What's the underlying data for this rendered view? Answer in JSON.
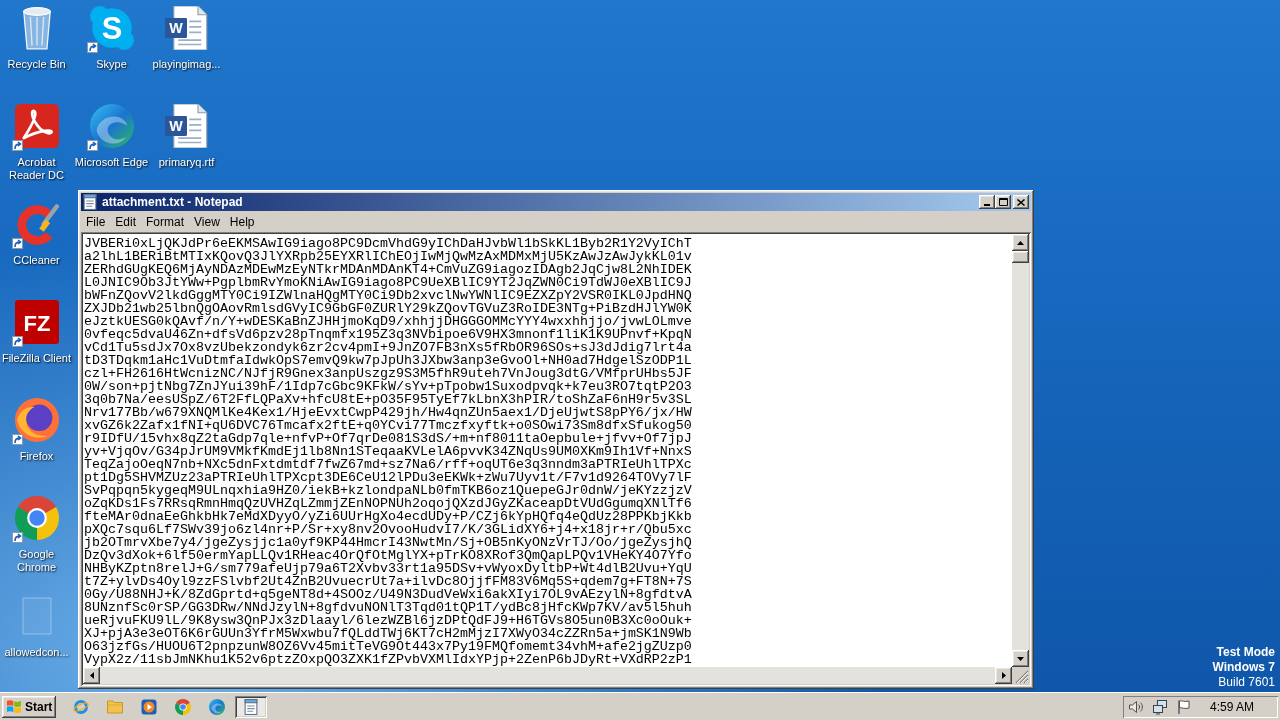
{
  "desktop": {
    "columns": [
      {
        "icons": [
          {
            "label": "Recycle Bin",
            "kind": "recycle-bin",
            "shortcut": false
          },
          {
            "label": "Acrobat Reader DC",
            "kind": "acrobat",
            "shortcut": true
          },
          {
            "label": "CCleaner",
            "kind": "ccleaner",
            "shortcut": true
          },
          {
            "label": "FileZilla Client",
            "kind": "filezilla",
            "glyph": "FZ",
            "shortcut": true
          },
          {
            "label": "Firefox",
            "kind": "firefox",
            "shortcut": true
          },
          {
            "label": "Google Chrome",
            "kind": "chrome",
            "shortcut": true
          },
          {
            "label": "allowedcon...",
            "kind": "blank",
            "shortcut": false
          }
        ]
      },
      {
        "icons": [
          {
            "label": "Skype",
            "kind": "skype",
            "glyph": "S",
            "shortcut": true
          },
          {
            "label": "Microsoft Edge",
            "kind": "edge",
            "shortcut": true
          }
        ]
      },
      {
        "icons": [
          {
            "label": "playingimag...",
            "kind": "word",
            "glyph": "W",
            "shortcut": false
          },
          {
            "label": "primaryq.rtf",
            "kind": "word",
            "glyph": "W",
            "shortcut": false
          }
        ]
      }
    ]
  },
  "notepad": {
    "title": "attachment.txt - Notepad",
    "menu": [
      "File",
      "Edit",
      "Format",
      "View",
      "Help"
    ],
    "lines": [
      "JVBERi0xLjQKJdPr6eEKMSAwIG9iago8PC9DcmVhdG9yIChDaHJvbWl1bSkKL1Byb2R1Y2VyIChT",
      "a2lhL1BERiBtMTIxKQovQ3JlYXRpb25EYXRlIChEOjIwMjQwMzAxMDMxMjU5KzAwJzAwJykKL01v",
      "ZERhdGUgKEQ6MjAyNDAzMDEwMzEyNTkrMDAnMDAnKT4+CmVuZG9iagozIDAgb2JqCjw8L2NhIDEK",
      "L0JNIC9Ob3JtYWw+PgplbmRvYmoKNiAwIG9iago8PC9UeXBlIC9YT2JqZWN0Ci9TdWJ0eXBlIC9J",
      "bWFnZQovV2lkdGggMTY0Ci9IZWlnaHQgMTY0Ci9Db2xvclNwYWNlIC9EZXZpY2VSR0IKL0JpdHNQ",
      "ZXJDb21wb25lbnQgOAovRmlsdGVyIC9GbGF0ZURlY29kZQovTGVuZ3RoIDE3NTg+PiBzdHJlYW0K",
      "eJztkUESG0kQAvf/n/Y+wDESKaBnZJHHjmoKqD9/xhhjjDHGGGOMMcYYY4wxxhhjjo/jvwLOLmve",
      "0vfeqc5dvaU46Zn+dfsVd6pzv28pTnqmfx195Z3q3NVbipoe6V9HX3mnonf1liK1K9UPnvf+KpqN",
      "vCd1Tu5sdJx7Ox8vzUbekzondyk6zr2cv4pmI+9JnZO7FB3nXs5fRbOR96SOs+sJ3dJdig7lrt4a",
      "tD3TDqkm1aHc1VuDtmfaIdwkOpS7emvQ9kw7pJpUh3JXbw3anp3eGvoOl+NH0ad7HdgelSzODP1L",
      "czl+FH2616HtWcnizNC/NJfjR9Gnex3anpUszgz9S3M5fhR9uteh7VnJoug3dtG/VMfprUHbs5JF",
      "0W/son+pjtNbg7ZnJYui39hF/1Idp7cGbc9KFkW/sYv+pTpobw1Suxodpvqk+k7eu3RO7tqtP2O3",
      "3q0b7Na/eesUSpZ/6T2FfLQPaXv+hfcU8tE+pO35F95TyEf7kLbnX3hPIR/toShZaF6nH9r5v3SL",
      "Nrv177Bb/w679XNQMlKe4Kex1/HjeEvxtCwpP429jh/Hw4qnZUn5aex1/DjeUjwtS8pPY6/jx/HW",
      "xvGZ6k2Zafx1fNI+qU6DVC76Tmcafx2ftE+q0YCvi77Tmczfxyftk+o0SOwi73Sm8dfxSfukog50",
      "r9IDfU/15vhx8qZ2taGdp7qle+nfvP+Of7qrDe081S3dS/+m+nf8011taOepbule+jfvv+Of7jpJ",
      "yv+VjqOv/G34pJrUM9VMkfKmdEj1lb8Nn1STeqaaKVLelA6pvvK34ZNqUs9UM0XKm9Ih1Vf+NnxS",
      "TeqZajoOeqN7nb+NXc5dnFxtdmtdf7fwZ67md+sz7Na6/rff+oqUT6e3q3nndm3aPTRIeUhlTPXc",
      "pt1Dg5SHVMZUz23aPTRIeUhlTPXcpt3DE6CeU12lPDu3eEKWk+zWu7Uyv1t/F7v1d9264TOVy7lF",
      "SvPqpqn5kygeqM9ULnqxhia9HZ0/iekB+kzlondpaNLb0fmTKB6oz1QuepeGJr0dnW/jeKYzzjzV",
      "oZqKDs1Fs7RRsqRmnHmqQzUVHZqLZmmjZEnNOPNUh2oqojQXzdJGyZKaceapDtVUdGgumqXNlTf6",
      "fteMAr0dnaEeGhkbHk7eMdXDyyO/yZi6UUrHgXo4ecdUDy+P/CZj6kYpHQfq4eQdUz28PPKbjKkb",
      "pXQc7squ6Lf7SWv39jo6zl4nr+P/Sr+xy8nv2OvooHudvI7/K/3GLidXY6+j4+x18jr+r/Qbu5xc",
      "jb2OTmrvXbe7y4/jgeZysjjc1a0yf9KP44HmcrI43NwtMn/Sj+OB5nKyONzVrTJ/Oo/jgeZysjhQ",
      "DzQv3dXok+6lf50ermYapLLQv1RHeac4OrQfOtMglYX+pTrKO8XRof3QmQapLPQv1VHeKY4O7Yfo",
      "NHByKZptn8relJ+G/sm779afeUjp79a6T2Xvbv33rt1a95DSv+vWyoxDyltbP+Wt4dlB2Uvu+YqU",
      "t7Z+ylvDs4Oyl9zzFSlvbf2Ut4ZnB2UvuecrUt7a+ilvDc8OjjfFM83V6Mq5S+qdem7g+FT8N+7S",
      "0Gy/U88NHJ+K/8ZdGprtd+q5geNT8d+4SOOz/U49N3DudVeWxi6akXIyi7OL9vAEzylN+8gfdtvA",
      "8UNznfSc0rSP/GG3DRw/NNdJzylN+8gfdvuNONlT3Tqd01tQP1T/ydBc8jHfcKWp7KV/av5l5huh",
      "ueRjvuFKU9lL/9K8ysw3QnPJx3zDlaayl/6lezWZBl6jzDPtQdFJ9+H6TGVs8O5un0B3Xc0oOuk+",
      "XJ+pjA3e3eOT6K6rGUUn3YfrM5Wxwbu7fQLddTWj6KT7cH2mMjzI7XWyO34cZZRn5a+jmSK1N9Wb",
      "O63jzfGs/HUOU6T2pnpzunW8OZ6Vv45mitTeVG9Ot443x7Py19FMQfomemt34vhM+afe2jgZUzp0",
      "VypX2z/11sbJmNKhu1K52v6ptzZOxpQO3ZXK1fZPvbVXMlIdxYPjp+2ZenP6bJDyRt+VXdRP2zP1"
    ]
  },
  "test_mode": [
    {
      "text": "Test Mode",
      "bold": true
    },
    {
      "text": "Windows 7",
      "bold": true
    },
    {
      "text": "Build 7601",
      "bold": false
    }
  ],
  "taskbar": {
    "start": "Start",
    "items": [
      {
        "kind": "ie",
        "selected": false
      },
      {
        "kind": "explorer",
        "selected": false
      },
      {
        "kind": "media",
        "selected": false
      },
      {
        "kind": "chrome",
        "selected": false
      },
      {
        "kind": "edge",
        "selected": false
      },
      {
        "kind": "notepad",
        "selected": true
      }
    ],
    "tray": [
      {
        "kind": "speaker"
      },
      {
        "kind": "network"
      },
      {
        "kind": "flag"
      }
    ],
    "clock": "4:59 AM"
  }
}
